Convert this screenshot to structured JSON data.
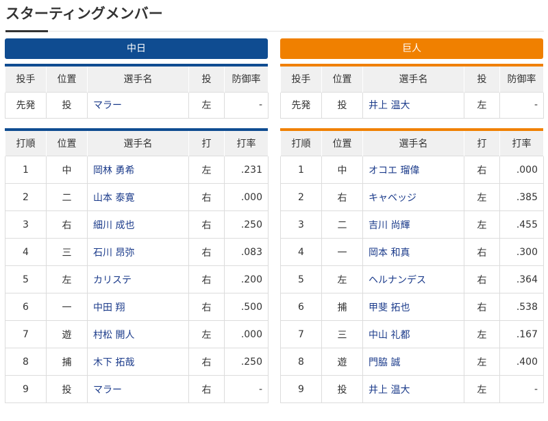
{
  "page": {
    "title": "スターティングメンバー"
  },
  "colors": {
    "chunichi": "#0f4c91",
    "giants": "#f08000"
  },
  "pitcher_headers": [
    "投手",
    "位置",
    "選手名",
    "投",
    "防御率"
  ],
  "lineup_headers": [
    "打順",
    "位置",
    "選手名",
    "打",
    "打率"
  ],
  "teams": [
    {
      "name": "中日",
      "pitcher": {
        "role": "先発",
        "pos": "投",
        "name": "マラー",
        "hand": "左",
        "era": "-"
      },
      "lineup": [
        {
          "order": "1",
          "pos": "中",
          "name": "岡林 勇希",
          "bat": "左",
          "avg": ".231"
        },
        {
          "order": "2",
          "pos": "二",
          "name": "山本 泰寛",
          "bat": "右",
          "avg": ".000"
        },
        {
          "order": "3",
          "pos": "右",
          "name": "細川 成也",
          "bat": "右",
          "avg": ".250"
        },
        {
          "order": "4",
          "pos": "三",
          "name": "石川 昂弥",
          "bat": "右",
          "avg": ".083"
        },
        {
          "order": "5",
          "pos": "左",
          "name": "カリステ",
          "bat": "右",
          "avg": ".200"
        },
        {
          "order": "6",
          "pos": "一",
          "name": "中田 翔",
          "bat": "右",
          "avg": ".500"
        },
        {
          "order": "7",
          "pos": "遊",
          "name": "村松 開人",
          "bat": "左",
          "avg": ".000"
        },
        {
          "order": "8",
          "pos": "捕",
          "name": "木下 拓哉",
          "bat": "右",
          "avg": ".250"
        },
        {
          "order": "9",
          "pos": "投",
          "name": "マラー",
          "bat": "右",
          "avg": "-"
        }
      ]
    },
    {
      "name": "巨人",
      "pitcher": {
        "role": "先発",
        "pos": "投",
        "name": "井上 温大",
        "hand": "左",
        "era": "-"
      },
      "lineup": [
        {
          "order": "1",
          "pos": "中",
          "name": "オコエ 瑠偉",
          "bat": "右",
          "avg": ".000"
        },
        {
          "order": "2",
          "pos": "右",
          "name": "キャベッジ",
          "bat": "左",
          "avg": ".385"
        },
        {
          "order": "3",
          "pos": "二",
          "name": "吉川 尚輝",
          "bat": "左",
          "avg": ".455"
        },
        {
          "order": "4",
          "pos": "一",
          "name": "岡本 和真",
          "bat": "右",
          "avg": ".300"
        },
        {
          "order": "5",
          "pos": "左",
          "name": "ヘルナンデス",
          "bat": "右",
          "avg": ".364"
        },
        {
          "order": "6",
          "pos": "捕",
          "name": "甲斐 拓也",
          "bat": "右",
          "avg": ".538"
        },
        {
          "order": "7",
          "pos": "三",
          "name": "中山 礼都",
          "bat": "左",
          "avg": ".167"
        },
        {
          "order": "8",
          "pos": "遊",
          "name": "門脇 誠",
          "bat": "左",
          "avg": ".400"
        },
        {
          "order": "9",
          "pos": "投",
          "name": "井上 温大",
          "bat": "左",
          "avg": "-"
        }
      ]
    }
  ]
}
